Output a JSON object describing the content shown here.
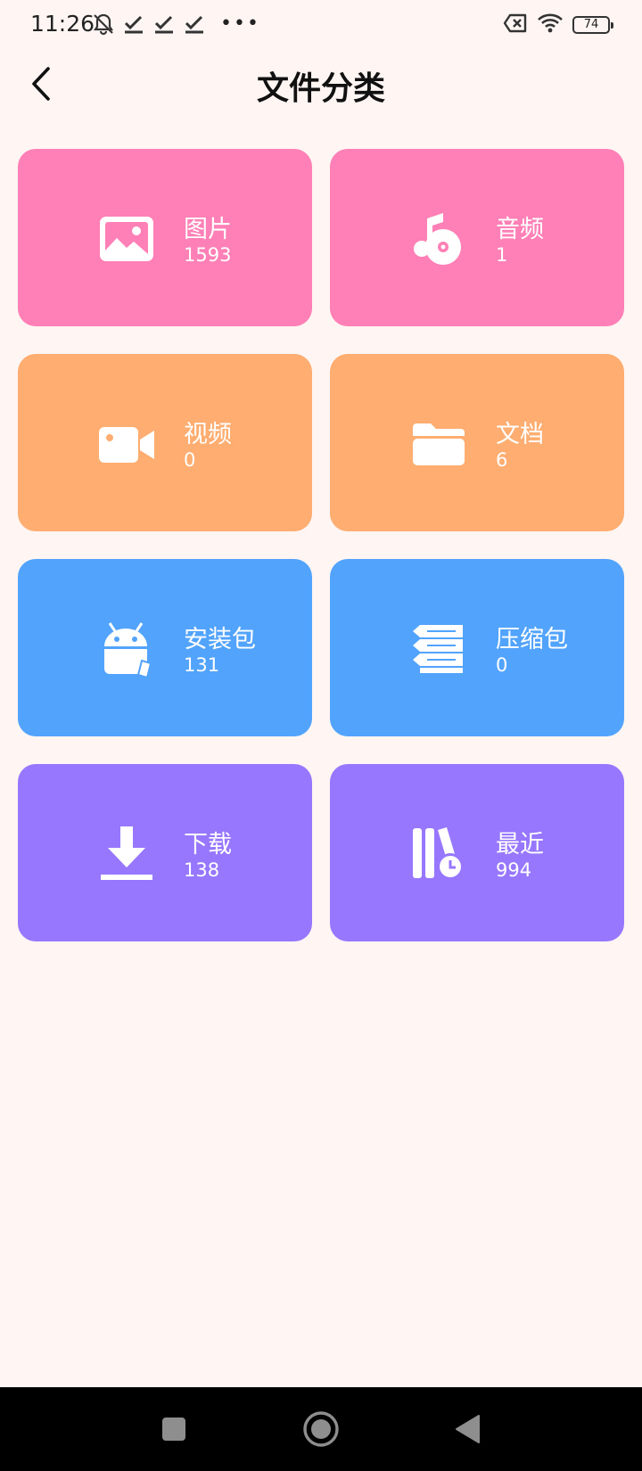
{
  "status_bar": {
    "time": "11:26",
    "battery": "74",
    "icons": [
      "notifications-off-icon",
      "check-icon",
      "check-icon",
      "check-icon",
      "more-dots-icon",
      "sim-error-icon",
      "wifi-icon",
      "battery-icon"
    ]
  },
  "header": {
    "title": "文件分类",
    "back_icon": "chevron-left-icon"
  },
  "categories": [
    {
      "label": "图片",
      "count": "1593",
      "icon": "image-icon",
      "color": "#ff80b6"
    },
    {
      "label": "音频",
      "count": "1",
      "icon": "music-icon",
      "color": "#ff80b6"
    },
    {
      "label": "视频",
      "count": "0",
      "icon": "video-camera-icon",
      "color": "#ffad70"
    },
    {
      "label": "文档",
      "count": "6",
      "icon": "folder-icon",
      "color": "#ffad70"
    },
    {
      "label": "安装包",
      "count": "131",
      "icon": "android-icon",
      "color": "#52a3fc"
    },
    {
      "label": "压缩包",
      "count": "0",
      "icon": "archive-layers-icon",
      "color": "#52a3fc"
    },
    {
      "label": "下载",
      "count": "138",
      "icon": "download-icon",
      "color": "#9877ff"
    },
    {
      "label": "最近",
      "count": "994",
      "icon": "recent-books-clock-icon",
      "color": "#9877ff"
    }
  ],
  "nav_bar": {
    "buttons": [
      "recents-square-icon",
      "home-circle-icon",
      "back-triangle-icon"
    ]
  }
}
